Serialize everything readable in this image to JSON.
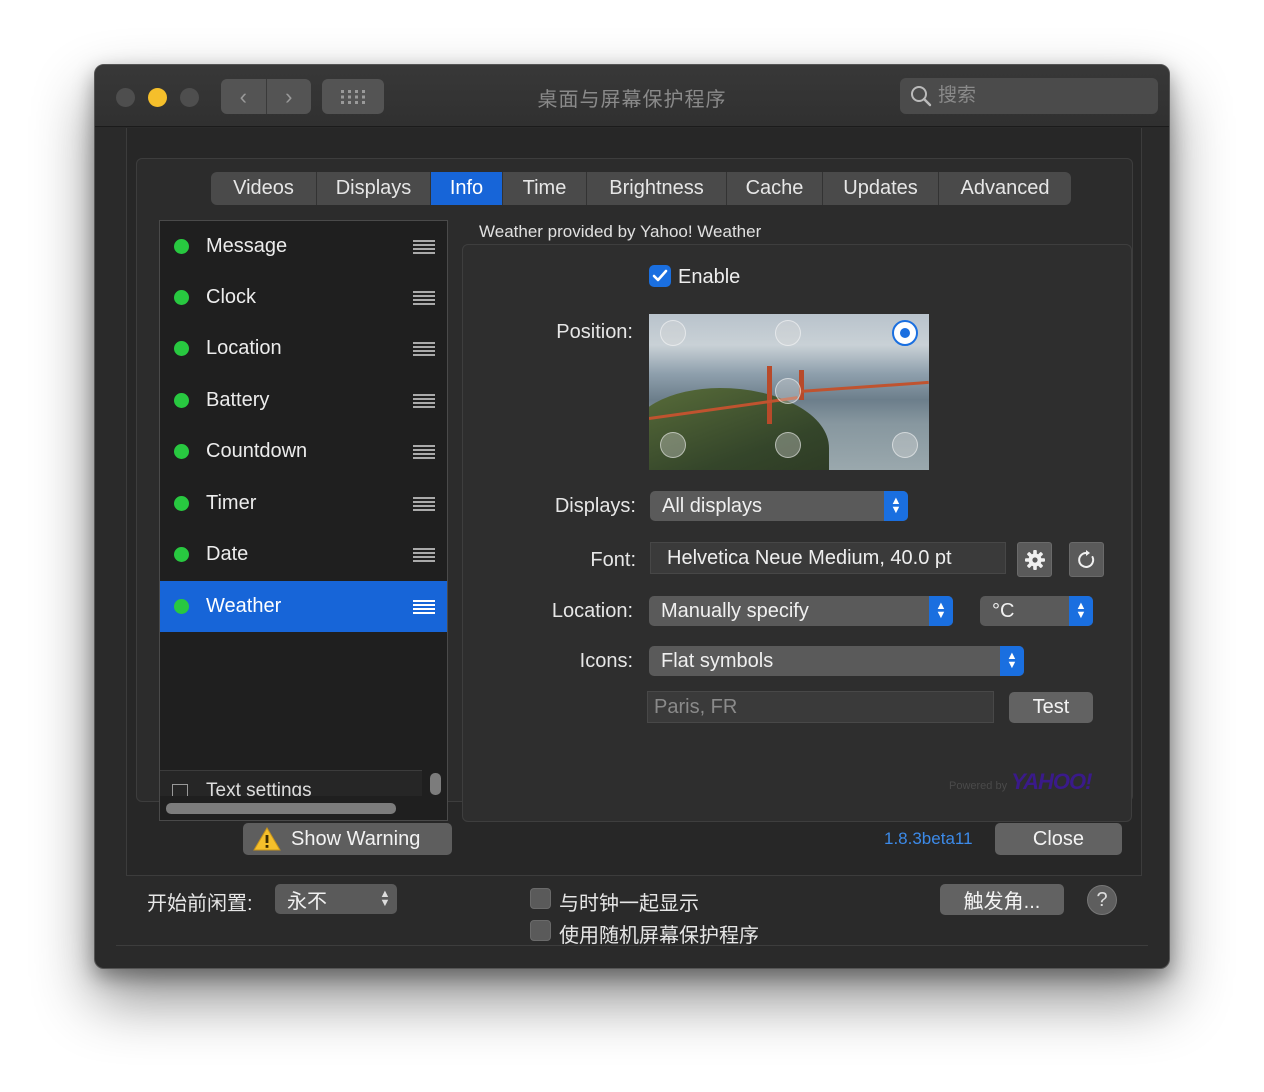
{
  "window": {
    "title": "桌面与屏幕保护程序"
  },
  "toolbar": {
    "back_label": "‹",
    "forward_label": "›"
  },
  "search": {
    "placeholder": "搜索"
  },
  "tabs": [
    {
      "label": "Videos"
    },
    {
      "label": "Displays"
    },
    {
      "label": "Info",
      "active": true
    },
    {
      "label": "Time"
    },
    {
      "label": "Brightness"
    },
    {
      "label": "Cache"
    },
    {
      "label": "Updates"
    },
    {
      "label": "Advanced"
    }
  ],
  "sidebar": {
    "items": [
      {
        "label": "Message"
      },
      {
        "label": "Clock"
      },
      {
        "label": "Location"
      },
      {
        "label": "Battery"
      },
      {
        "label": "Countdown"
      },
      {
        "label": "Timer"
      },
      {
        "label": "Date"
      },
      {
        "label": "Weather",
        "selected": true
      }
    ],
    "text_settings": "Text settings"
  },
  "weather": {
    "provided_by": "Weather provided by Yahoo! Weather",
    "enable_label": "Enable",
    "enabled": true,
    "position_label": "Position:",
    "displays_label": "Displays:",
    "displays_value": "All displays",
    "font_label": "Font:",
    "font_value": "Helvetica Neue Medium, 40.0 pt",
    "location_label": "Location:",
    "location_value": "Manually specify",
    "unit_value": "°C",
    "icons_label": "Icons:",
    "icons_value": "Flat symbols",
    "location_placeholder": "Paris, FR",
    "test_label": "Test",
    "powered_by": "Powered by",
    "yahoo_logo": "YAHOO!"
  },
  "footer": {
    "warning_label": "Show Warning",
    "version": "1.8.3beta11",
    "close_label": "Close"
  },
  "bottom": {
    "idle_label": "开始前闲置:",
    "idle_value": "永不",
    "show_clock_label": "与时钟一起显示",
    "random_label": "使用随机屏幕保护程序",
    "hot_corners_label": "触发角...",
    "help_label": "?"
  },
  "colors": {
    "accent": "#1765d8",
    "status_green": "#28c840",
    "warning_yellow": "#f5bf2b"
  }
}
